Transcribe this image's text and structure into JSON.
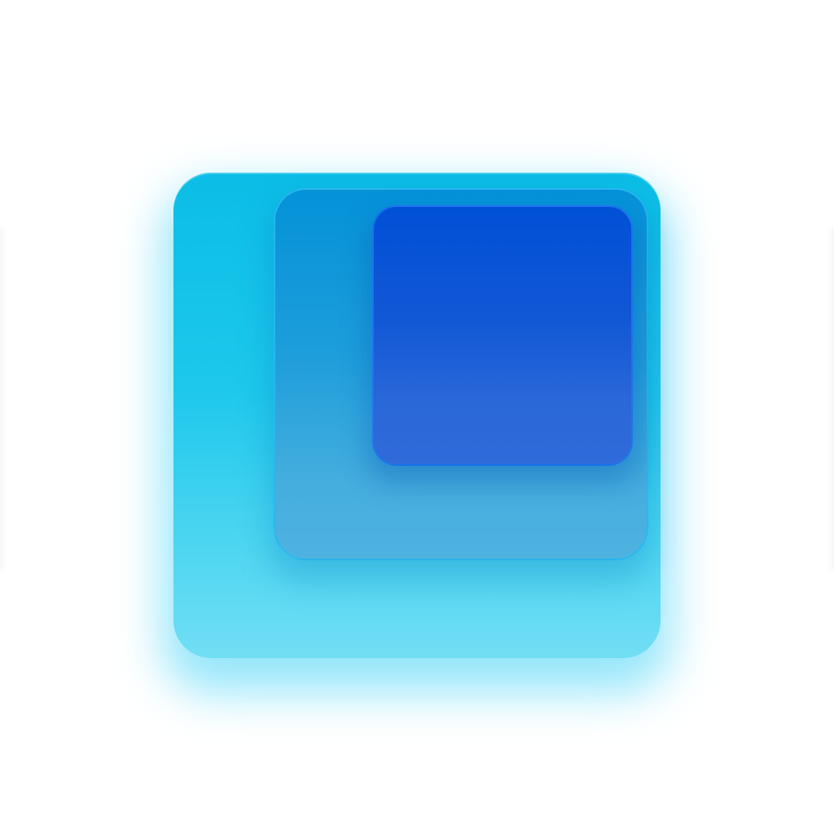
{
  "icon": {
    "name": "stacked-squares-icon",
    "colors": {
      "background": "#ffffff",
      "back_layer": "#1ec8ec",
      "middle_layer": "#1e9edb",
      "front_layer": "#1258d6",
      "glow": "#3cd2f5"
    }
  }
}
